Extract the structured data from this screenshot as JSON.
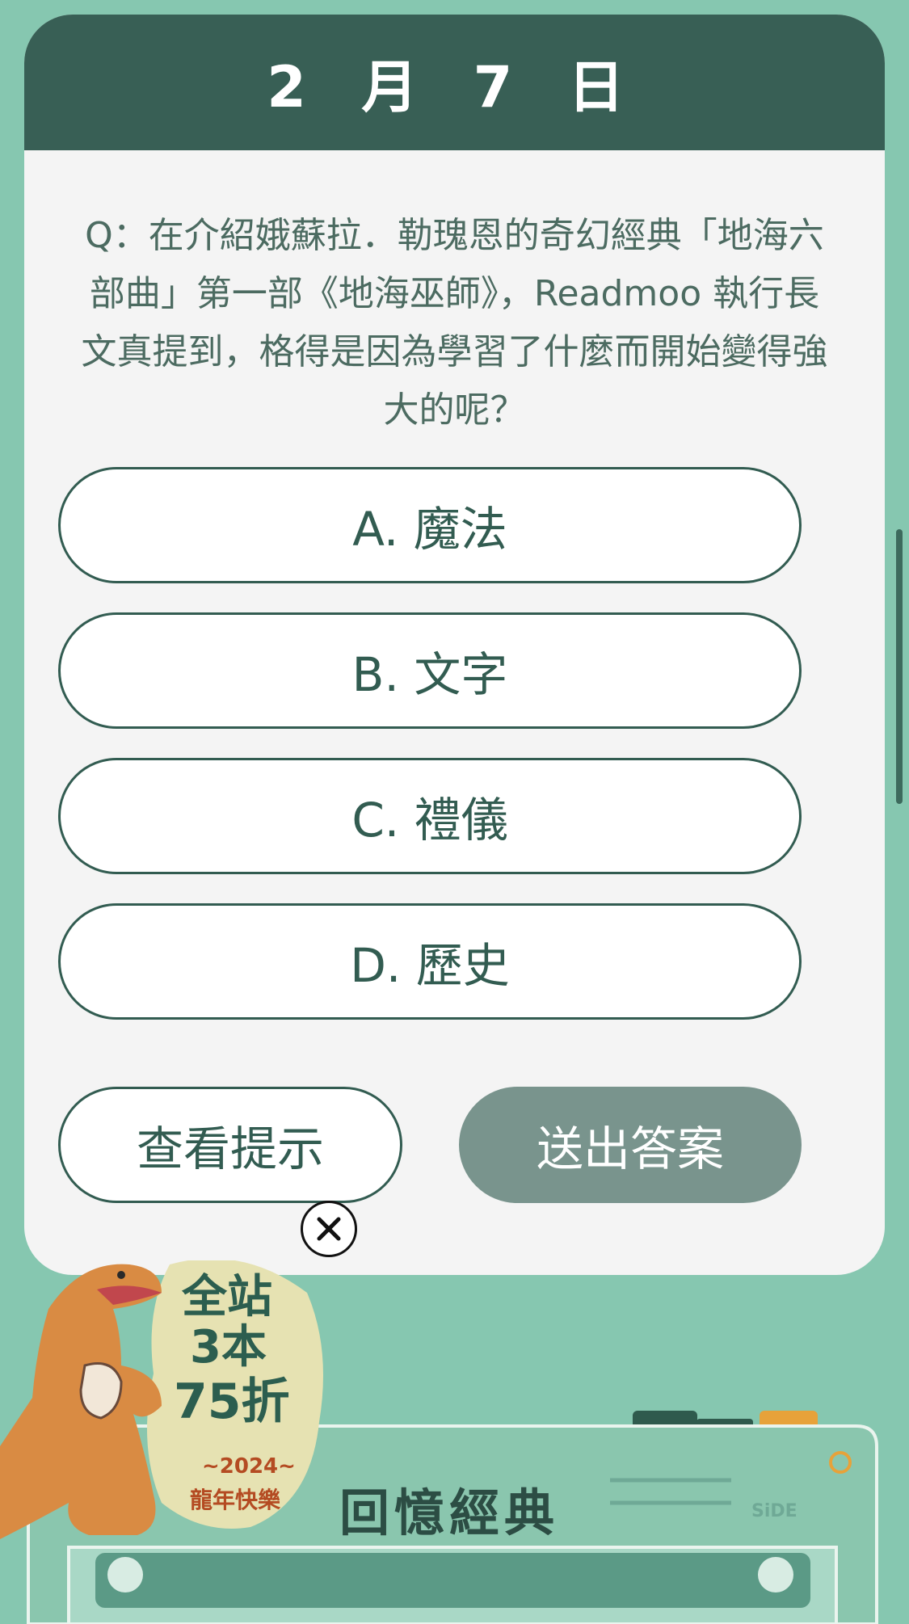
{
  "header": {
    "date": "2 月 7 日"
  },
  "question": {
    "text": "Q：在介紹娥蘇拉．勒瑰恩的奇幻經典「地海六部曲」第一部《地海巫師》，Readmoo 執行長文真提到，格得是因為學習了什麼而開始變得強大的呢？"
  },
  "options": [
    {
      "label": "A. 魔法"
    },
    {
      "label": "B. 文字"
    },
    {
      "label": "C. 禮儀"
    },
    {
      "label": "D. 歷史"
    }
  ],
  "actions": {
    "hint_label": "查看提示",
    "submit_label": "送出答案"
  },
  "promo": {
    "line1": "全站",
    "line2": "3本",
    "line3": "75折",
    "year": "~2024~",
    "greeting": "龍年快樂"
  },
  "banner": {
    "title": "回憶經典",
    "logo_text": "SiDE"
  },
  "colors": {
    "background": "#86c7b0",
    "header": "#385f55",
    "card": "#f4f4f4",
    "outline": "#325c51",
    "submit": "#79948d"
  }
}
